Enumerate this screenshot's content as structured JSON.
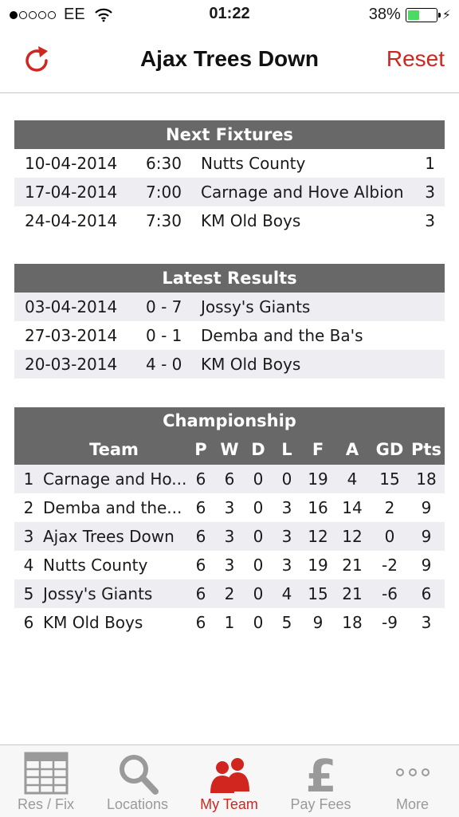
{
  "status": {
    "carrier": "EE",
    "time": "01:22",
    "battery": "38%"
  },
  "nav": {
    "title": "Ajax Trees Down",
    "reset_label": "Reset"
  },
  "fixtures": {
    "title": "Next Fixtures",
    "rows": [
      {
        "date": "10-04-2014",
        "time": "6:30",
        "opponent": "Nutts County",
        "num": "1"
      },
      {
        "date": "17-04-2014",
        "time": "7:00",
        "opponent": "Carnage and Hove Albion",
        "num": "3"
      },
      {
        "date": "24-04-2014",
        "time": "7:30",
        "opponent": "KM Old Boys",
        "num": "3"
      }
    ]
  },
  "results": {
    "title": "Latest Results",
    "rows": [
      {
        "date": "03-04-2014",
        "score": "0 - 7",
        "opponent": "Jossy's Giants"
      },
      {
        "date": "27-03-2014",
        "score": "0 - 1",
        "opponent": "Demba and the Ba's"
      },
      {
        "date": "20-03-2014",
        "score": "4 - 0",
        "opponent": "KM Old Boys"
      }
    ]
  },
  "championship": {
    "title": "Championship",
    "columns": {
      "team": "Team",
      "p": "P",
      "w": "W",
      "d": "D",
      "l": "L",
      "f": "F",
      "a": "A",
      "gd": "GD",
      "pts": "Pts"
    },
    "rows": [
      {
        "pos": "1",
        "team": "Carnage and Ho...",
        "p": "6",
        "w": "6",
        "d": "0",
        "l": "0",
        "f": "19",
        "a": "4",
        "gd": "15",
        "pts": "18"
      },
      {
        "pos": "2",
        "team": "Demba and the...",
        "p": "6",
        "w": "3",
        "d": "0",
        "l": "3",
        "f": "16",
        "a": "14",
        "gd": "2",
        "pts": "9"
      },
      {
        "pos": "3",
        "team": "Ajax Trees Down",
        "p": "6",
        "w": "3",
        "d": "0",
        "l": "3",
        "f": "12",
        "a": "12",
        "gd": "0",
        "pts": "9"
      },
      {
        "pos": "4",
        "team": "Nutts County",
        "p": "6",
        "w": "3",
        "d": "0",
        "l": "3",
        "f": "19",
        "a": "21",
        "gd": "-2",
        "pts": "9"
      },
      {
        "pos": "5",
        "team": "Jossy's Giants",
        "p": "6",
        "w": "2",
        "d": "0",
        "l": "4",
        "f": "15",
        "a": "21",
        "gd": "-6",
        "pts": "6"
      },
      {
        "pos": "6",
        "team": "KM Old Boys",
        "p": "6",
        "w": "1",
        "d": "0",
        "l": "5",
        "f": "9",
        "a": "18",
        "gd": "-9",
        "pts": "3"
      }
    ]
  },
  "tabs": [
    {
      "label": "Res / Fix",
      "icon": "calendar-grid-icon"
    },
    {
      "label": "Locations",
      "icon": "magnifier-icon"
    },
    {
      "label": "My Team",
      "icon": "team-icon",
      "active": true
    },
    {
      "label": "Pay Fees",
      "icon": "pound-icon"
    },
    {
      "label": "More",
      "icon": "more-dots-icon"
    }
  ],
  "colors": {
    "accent": "#d0261f",
    "header_bg": "#686868",
    "alt_row": "#ededf2",
    "tab_inactive": "#9a9a9a"
  }
}
